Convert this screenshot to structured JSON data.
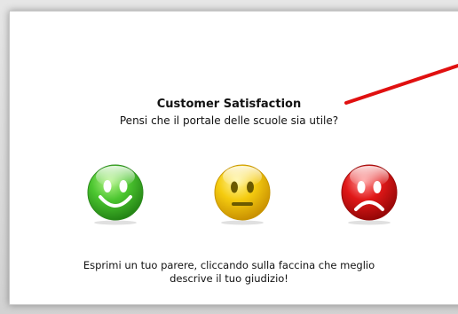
{
  "survey": {
    "title": "Customer Satisfaction",
    "question": "Pensi che il portale delle scuole sia utile?",
    "note_line1": "Esprimi un tuo parere, cliccando sulla faccina che meglio",
    "note_line2": "descrive il tuo giudizio!"
  },
  "faces": [
    {
      "icon": "smiley-happy-icon",
      "color": "#3db82a"
    },
    {
      "icon": "smiley-neutral-icon",
      "color": "#f2c400"
    },
    {
      "icon": "smiley-sad-icon",
      "color": "#d81414"
    }
  ],
  "colors": {
    "arrow": "#e01010"
  }
}
